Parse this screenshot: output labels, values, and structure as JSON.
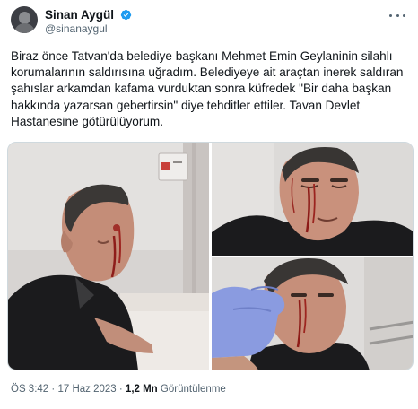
{
  "author": {
    "display_name": "Sinan Aygül",
    "handle": "@sinanaygul",
    "verified": true,
    "avatar_icon": "user-avatar-photo"
  },
  "tweet": {
    "text": "Biraz önce Tatvan'da belediye başkanı Mehmet Emin Geylaninin silahlı korumalarının saldırısına uğradım. Belediyeye ait araçtan inerek saldıran şahıslar arkamdan kafama vurduktan sonra küfredek \"Bir daha başkan hakkında yazarsan gebertirsin\" diye tehditler ettiler. Tavan Devlet Hastanesine götürülüyorum."
  },
  "media": {
    "count": 3,
    "photos": [
      {
        "description_icon": "photo-injured-man-hospital-bed"
      },
      {
        "description_icon": "photo-injured-man-closeup"
      },
      {
        "description_icon": "photo-injured-man-gloved-hand"
      }
    ]
  },
  "meta": {
    "time": "ÖS 3:42",
    "separator": "·",
    "date": "17 Haz 2023",
    "views_count": "1,2 Mn",
    "views_label": "Görüntülenme"
  },
  "colors": {
    "verified_blue": "#1d9bf0",
    "text_primary": "#0f1419",
    "text_secondary": "#536471"
  }
}
